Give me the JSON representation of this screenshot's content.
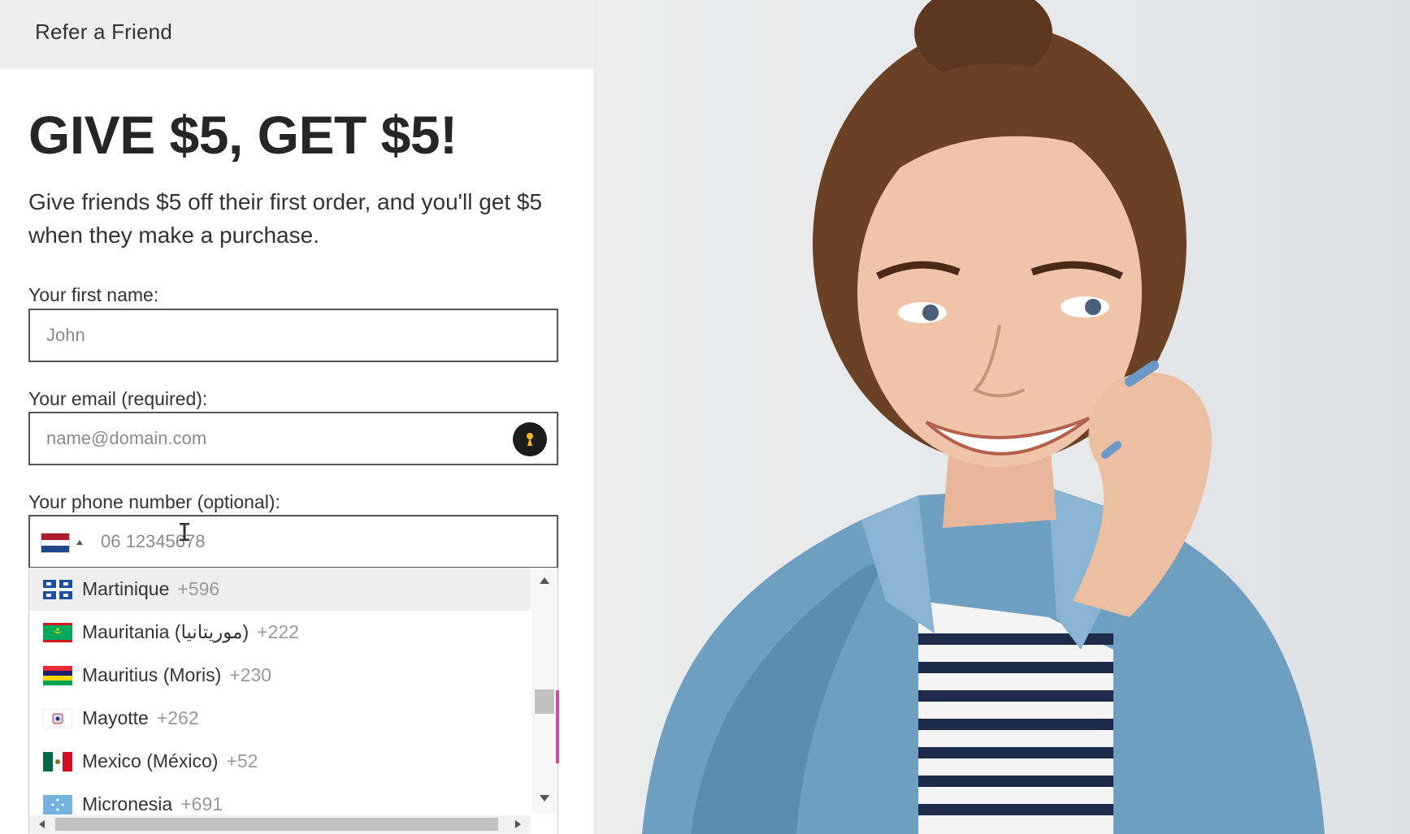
{
  "header": {
    "title": "Refer a Friend"
  },
  "hero": {
    "headline": "GIVE $5, GET $5!",
    "subtitle": "Give friends $5 off their first order, and you'll get $5 when they make a purchase."
  },
  "form": {
    "first_name": {
      "label": "Your first name:",
      "placeholder": "John"
    },
    "email": {
      "label": "Your email (required):",
      "placeholder": "name@domain.com",
      "icon": "password-manager-icon"
    },
    "phone": {
      "label": "Your phone number (optional):",
      "placeholder": "06 12345678",
      "selected_flag": "netherlands-flag"
    }
  },
  "country_dropdown": {
    "items": [
      {
        "name": "Martinique",
        "code": "+596",
        "flag": "martinique-flag",
        "highlighted": true
      },
      {
        "name": "Mauritania (موريتانيا)",
        "code": "+222",
        "flag": "mauritania-flag"
      },
      {
        "name": "Mauritius (Moris)",
        "code": "+230",
        "flag": "mauritius-flag"
      },
      {
        "name": "Mayotte",
        "code": "+262",
        "flag": "mayotte-flag"
      },
      {
        "name": "Mexico (México)",
        "code": "+52",
        "flag": "mexico-flag"
      },
      {
        "name": "Micronesia",
        "code": "+691",
        "flag": "micronesia-flag"
      }
    ]
  },
  "colors": {
    "topbar_bg": "#eeeeee",
    "headline": "#262626",
    "input_border": "#555555",
    "password_icon_bg": "#1b1b1b",
    "password_icon_fg": "#f1b81b",
    "accent_pink": "#c7529b"
  }
}
